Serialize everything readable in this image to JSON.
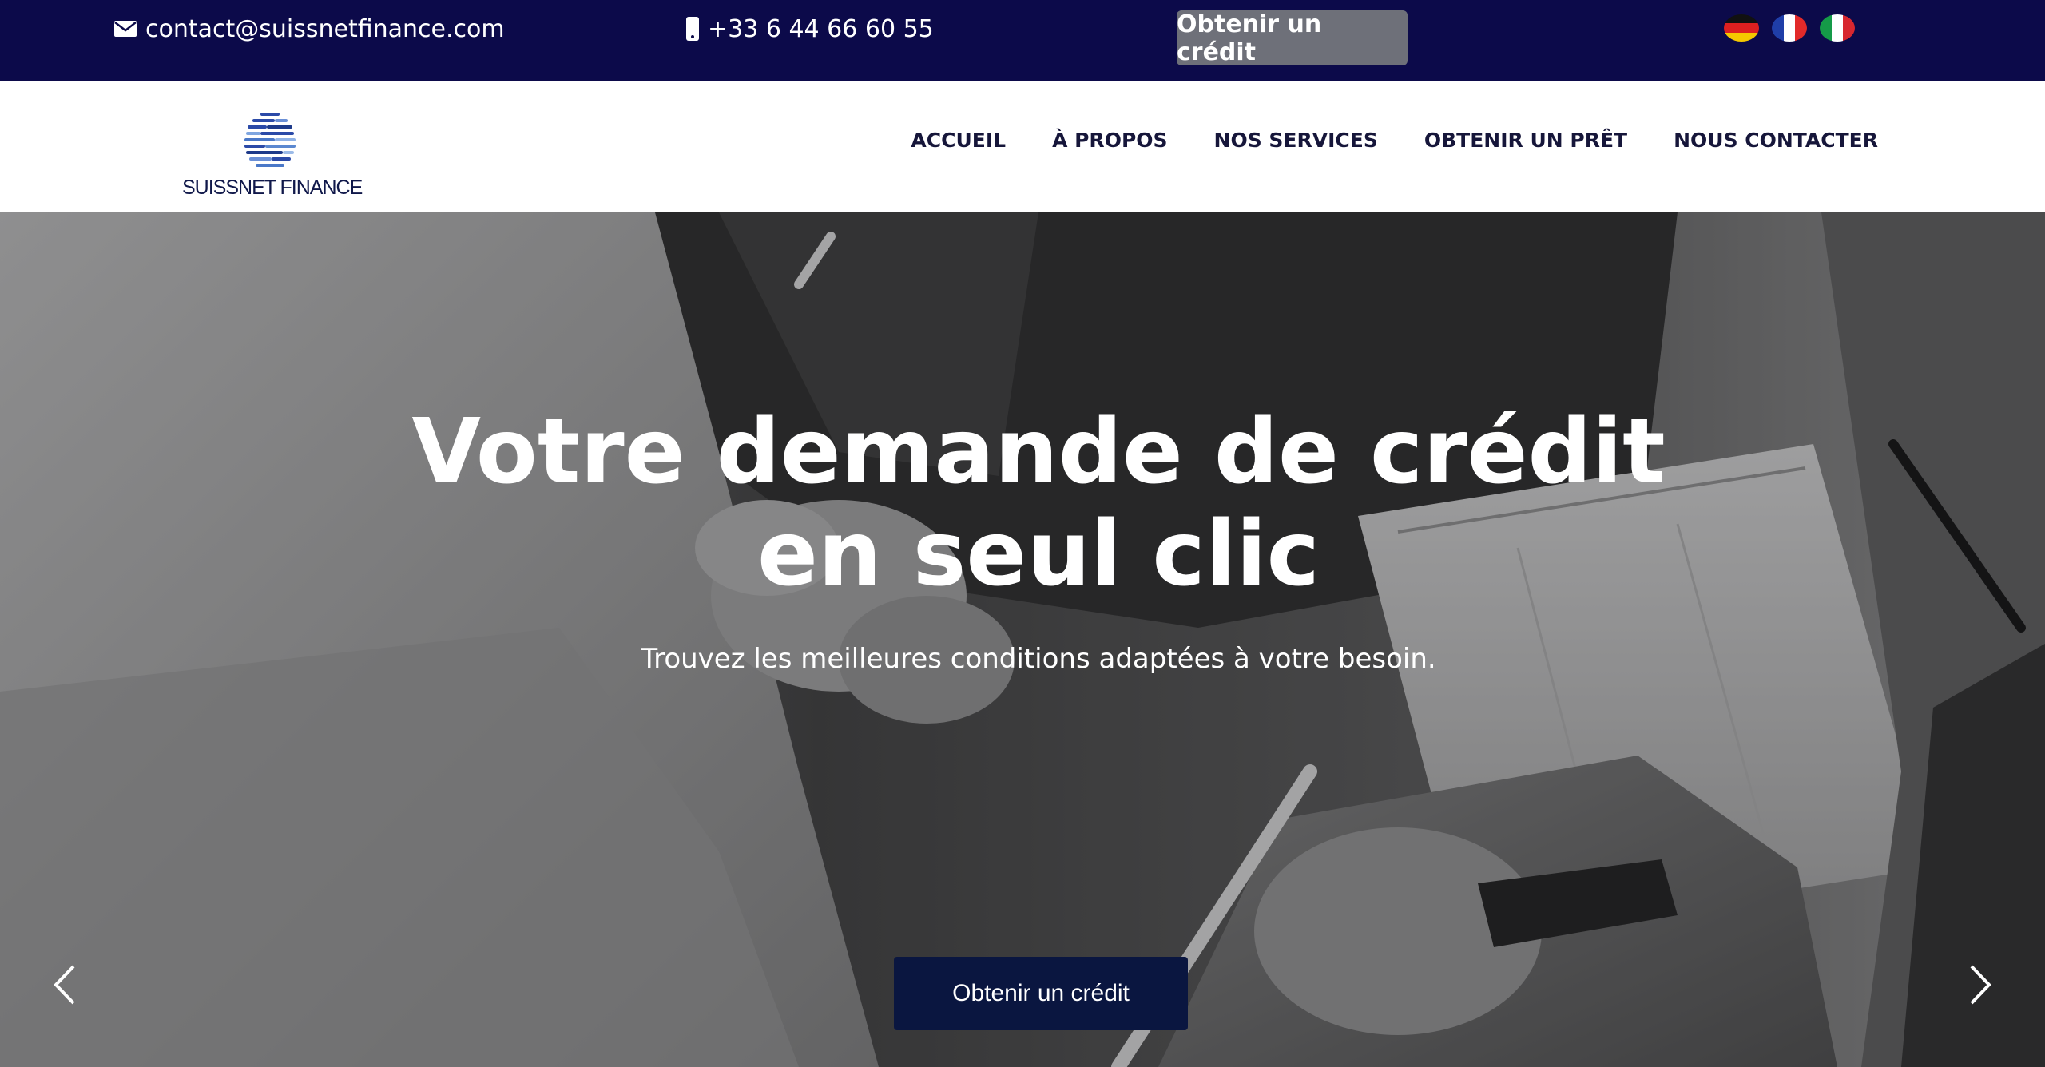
{
  "topbar": {
    "email": "contact@suissnetfinance.com",
    "phone": "+33 6 44 66 60 55",
    "cta_label": "Obtenir un crédit",
    "background_color": "#0c0a4a",
    "cta_color": "#6e7079",
    "icons": {
      "email": "envelope-icon",
      "phone": "mobile-phone-icon"
    },
    "languages": [
      "de",
      "fr",
      "it"
    ]
  },
  "header": {
    "logo_text": "SUISSNET FINANCE",
    "nav": {
      "home": "ACCUEIL",
      "about": "À PROPOS",
      "services": "NOS SERVICES",
      "loan": "OBTENIR UN PRÊT",
      "contact": "NOUS CONTACTER"
    }
  },
  "hero": {
    "title": "Votre demande de crédit en seul clic",
    "subtitle": "Trouvez les meilleures conditions adaptées à votre besoin.",
    "cta_label": "Obtenir un crédit",
    "cta_color": "#0a1640",
    "icons": {
      "prev": "chevron-left-icon",
      "next": "chevron-right-icon"
    }
  }
}
